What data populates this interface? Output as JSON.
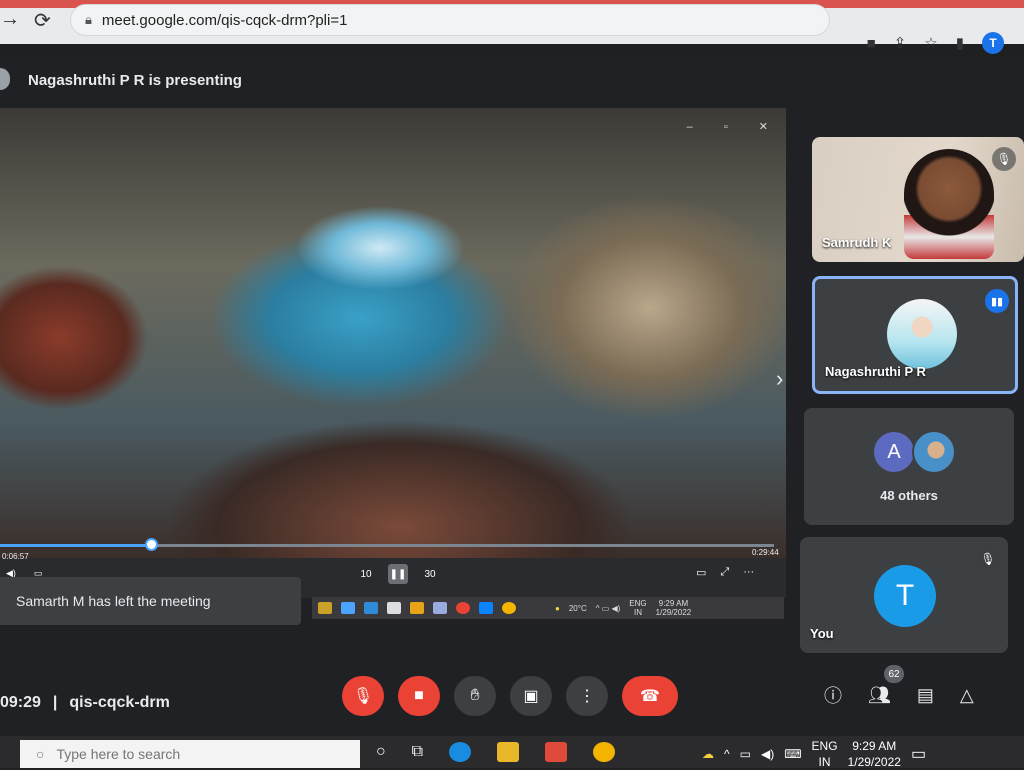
{
  "browser": {
    "url": "meet.google.com/qis-cqck-drm?pli=1",
    "profile_initial": "T"
  },
  "meeting": {
    "presenting_text": "Nagashruthi P R is presenting",
    "time": "09:29",
    "separator": "|",
    "code": "qis-cqck-drm",
    "toast": "Samarth M has left the meeting",
    "people_count": "62"
  },
  "player": {
    "elapsed": "0:06:57",
    "remaining": "0:29:44",
    "progress": 0.195,
    "skip_back": "10",
    "skip_fwd": "30"
  },
  "inner_taskbar": {
    "temp": "20°C",
    "lang_top": "ENG",
    "lang_bottom": "IN",
    "time": "9:29 AM",
    "date": "1/29/2022"
  },
  "participants": {
    "p1_name": "Samrudh K",
    "p2_name": "Nagashruthi P R",
    "others_initial": "A",
    "others_label": "48 others",
    "you_initial": "T",
    "you_label": "You"
  },
  "taskbar": {
    "search_placeholder": "Type here to search",
    "lang_top": "ENG",
    "lang_bottom": "IN",
    "time": "9:29 AM",
    "date": "1/29/2022"
  },
  "colors": {
    "accent_blue": "#1a73e8",
    "end_call_red": "#ea4335",
    "meet_bg": "#202124"
  }
}
